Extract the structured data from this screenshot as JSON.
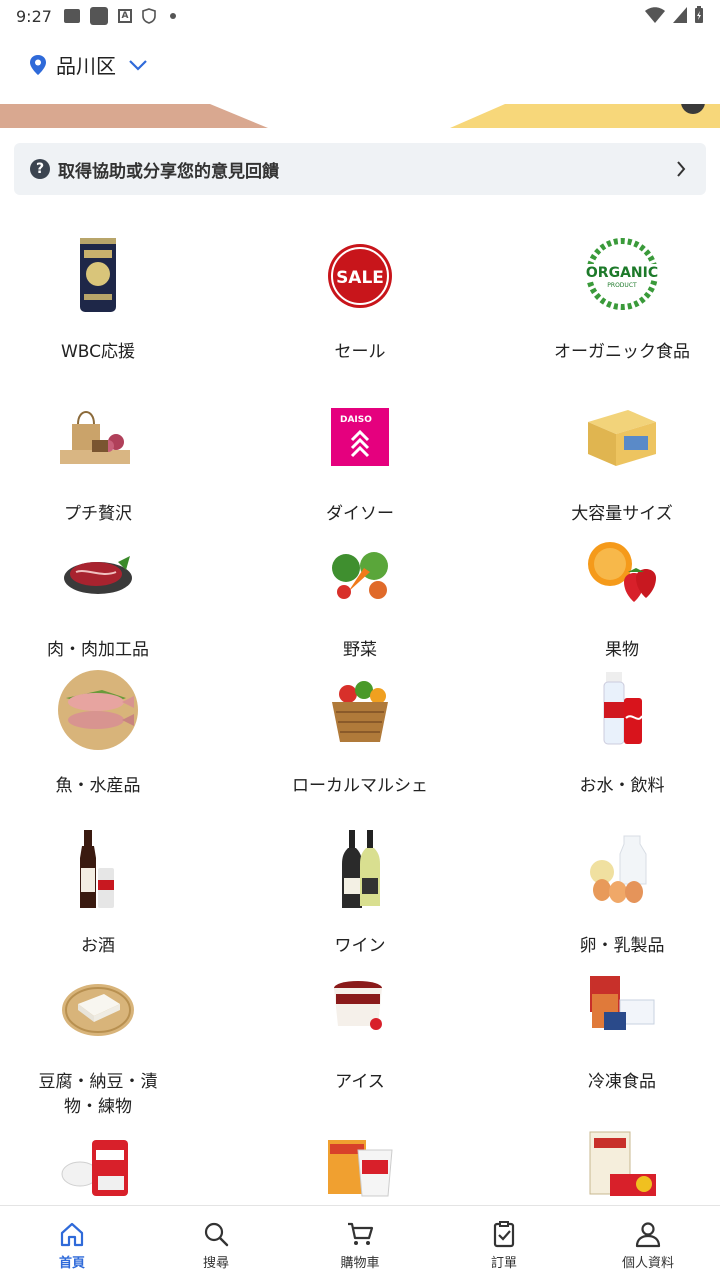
{
  "status_bar": {
    "time": "9:27"
  },
  "location": {
    "name": "品川区"
  },
  "feedback": {
    "text": "取得協助或分享您的意見回饋"
  },
  "categories": [
    {
      "label": "WBC応援",
      "icon": "beer-can-icon"
    },
    {
      "label": "セール",
      "icon": "sale-badge-icon"
    },
    {
      "label": "オーガニック食品",
      "icon": "organic-badge-icon"
    },
    {
      "label": "プチ贅沢",
      "icon": "gift-bag-icon"
    },
    {
      "label": "ダイソー",
      "icon": "daiso-logo-icon"
    },
    {
      "label": "大容量サイズ",
      "icon": "bulk-box-icon"
    },
    {
      "label": "肉・肉加工品",
      "icon": "meat-icon"
    },
    {
      "label": "野菜",
      "icon": "vegetables-icon"
    },
    {
      "label": "果物",
      "icon": "fruit-icon"
    },
    {
      "label": "魚・水産品",
      "icon": "fish-icon"
    },
    {
      "label": "ローカルマルシェ",
      "icon": "basket-icon"
    },
    {
      "label": "お水・飲料",
      "icon": "drinks-icon"
    },
    {
      "label": "お酒",
      "icon": "sake-bottle-icon"
    },
    {
      "label": "ワイン",
      "icon": "wine-bottle-icon"
    },
    {
      "label": "卵・乳製品",
      "icon": "eggs-dairy-icon"
    },
    {
      "label": "豆腐・納豆・漬物・練物",
      "icon": "tofu-icon"
    },
    {
      "label": "アイス",
      "icon": "ice-cream-icon"
    },
    {
      "label": "冷凍食品",
      "icon": "frozen-food-icon"
    },
    {
      "label": "",
      "icon": "rice-flour-icon"
    },
    {
      "label": "",
      "icon": "instant-food-icon"
    },
    {
      "label": "",
      "icon": "noodles-icon"
    }
  ],
  "bottom_nav": [
    {
      "label": "首頁",
      "icon": "home-icon",
      "active": true
    },
    {
      "label": "搜尋",
      "icon": "search-icon",
      "active": false
    },
    {
      "label": "購物車",
      "icon": "cart-icon",
      "active": false
    },
    {
      "label": "訂單",
      "icon": "orders-icon",
      "active": false
    },
    {
      "label": "個人資料",
      "icon": "profile-icon",
      "active": false
    }
  ],
  "colors": {
    "accent": "#2f6ad9",
    "feedback_bg": "#eff2f5"
  }
}
